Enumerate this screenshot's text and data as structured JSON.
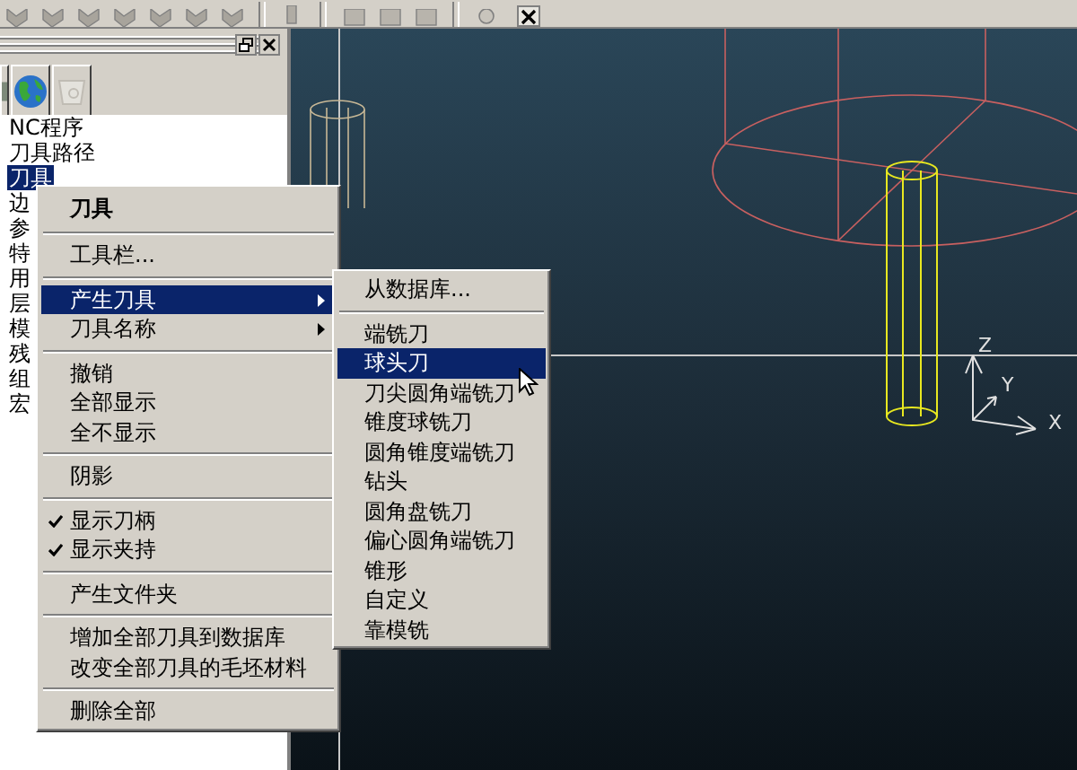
{
  "tree": [
    {
      "label": "NC程序",
      "selected": false
    },
    {
      "label": "刀具路径",
      "selected": false
    },
    {
      "label": "刀具",
      "selected": true
    },
    {
      "label": "边",
      "selected": false
    },
    {
      "label": "参",
      "selected": false
    },
    {
      "label": "特",
      "selected": false
    },
    {
      "label": "用",
      "selected": false
    },
    {
      "label": "层",
      "selected": false
    },
    {
      "label": "模",
      "selected": false
    },
    {
      "label": "残",
      "selected": false
    },
    {
      "label": "组",
      "selected": false
    },
    {
      "label": "宏",
      "selected": false
    }
  ],
  "context_menu": {
    "items": [
      {
        "kind": "header",
        "label": "刀具",
        "selected": false
      },
      {
        "kind": "separator"
      },
      {
        "kind": "item",
        "label": "工具栏...",
        "selected": false,
        "checked": false
      },
      {
        "kind": "separator"
      },
      {
        "kind": "submenu",
        "label": "产生刀具",
        "selected": true,
        "checked": false
      },
      {
        "kind": "submenu",
        "label": "刀具名称",
        "selected": false,
        "checked": false
      },
      {
        "kind": "separator"
      },
      {
        "kind": "item",
        "label": "撤销",
        "selected": false,
        "checked": false
      },
      {
        "kind": "item",
        "label": "全部显示",
        "selected": false,
        "checked": false
      },
      {
        "kind": "item",
        "label": "全不显示",
        "selected": false,
        "checked": false
      },
      {
        "kind": "separator"
      },
      {
        "kind": "item",
        "label": "阴影",
        "selected": false,
        "checked": false
      },
      {
        "kind": "separator"
      },
      {
        "kind": "item",
        "label": "显示刀柄",
        "selected": false,
        "checked": true
      },
      {
        "kind": "item",
        "label": "显示夹持",
        "selected": false,
        "checked": true
      },
      {
        "kind": "separator"
      },
      {
        "kind": "item",
        "label": "产生文件夹",
        "selected": false,
        "checked": false
      },
      {
        "kind": "separator"
      },
      {
        "kind": "item",
        "label": "增加全部刀具到数据库",
        "selected": false,
        "checked": false
      },
      {
        "kind": "item",
        "label": "改变全部刀具的毛坯材料",
        "selected": false,
        "checked": false
      },
      {
        "kind": "separator"
      },
      {
        "kind": "item",
        "label": "删除全部",
        "selected": false,
        "checked": false
      }
    ]
  },
  "submenu": {
    "items": [
      {
        "kind": "item",
        "label": "从数据库...",
        "selected": false
      },
      {
        "kind": "separator"
      },
      {
        "kind": "item",
        "label": "端铣刀",
        "selected": false
      },
      {
        "kind": "item",
        "label": "球头刀",
        "selected": true
      },
      {
        "kind": "item",
        "label": "刀尖圆角端铣刀",
        "selected": false
      },
      {
        "kind": "item",
        "label": "锥度球铣刀",
        "selected": false
      },
      {
        "kind": "item",
        "label": "圆角锥度端铣刀",
        "selected": false
      },
      {
        "kind": "item",
        "label": "钻头",
        "selected": false
      },
      {
        "kind": "item",
        "label": "圆角盘铣刀",
        "selected": false
      },
      {
        "kind": "item",
        "label": "偏心圆角端铣刀",
        "selected": false
      },
      {
        "kind": "item",
        "label": "锥形",
        "selected": false
      },
      {
        "kind": "item",
        "label": "自定义",
        "selected": false
      },
      {
        "kind": "item",
        "label": "靠模铣",
        "selected": false
      }
    ]
  },
  "viewport": {
    "axis_labels": [
      "Z",
      "Y",
      "X"
    ]
  }
}
